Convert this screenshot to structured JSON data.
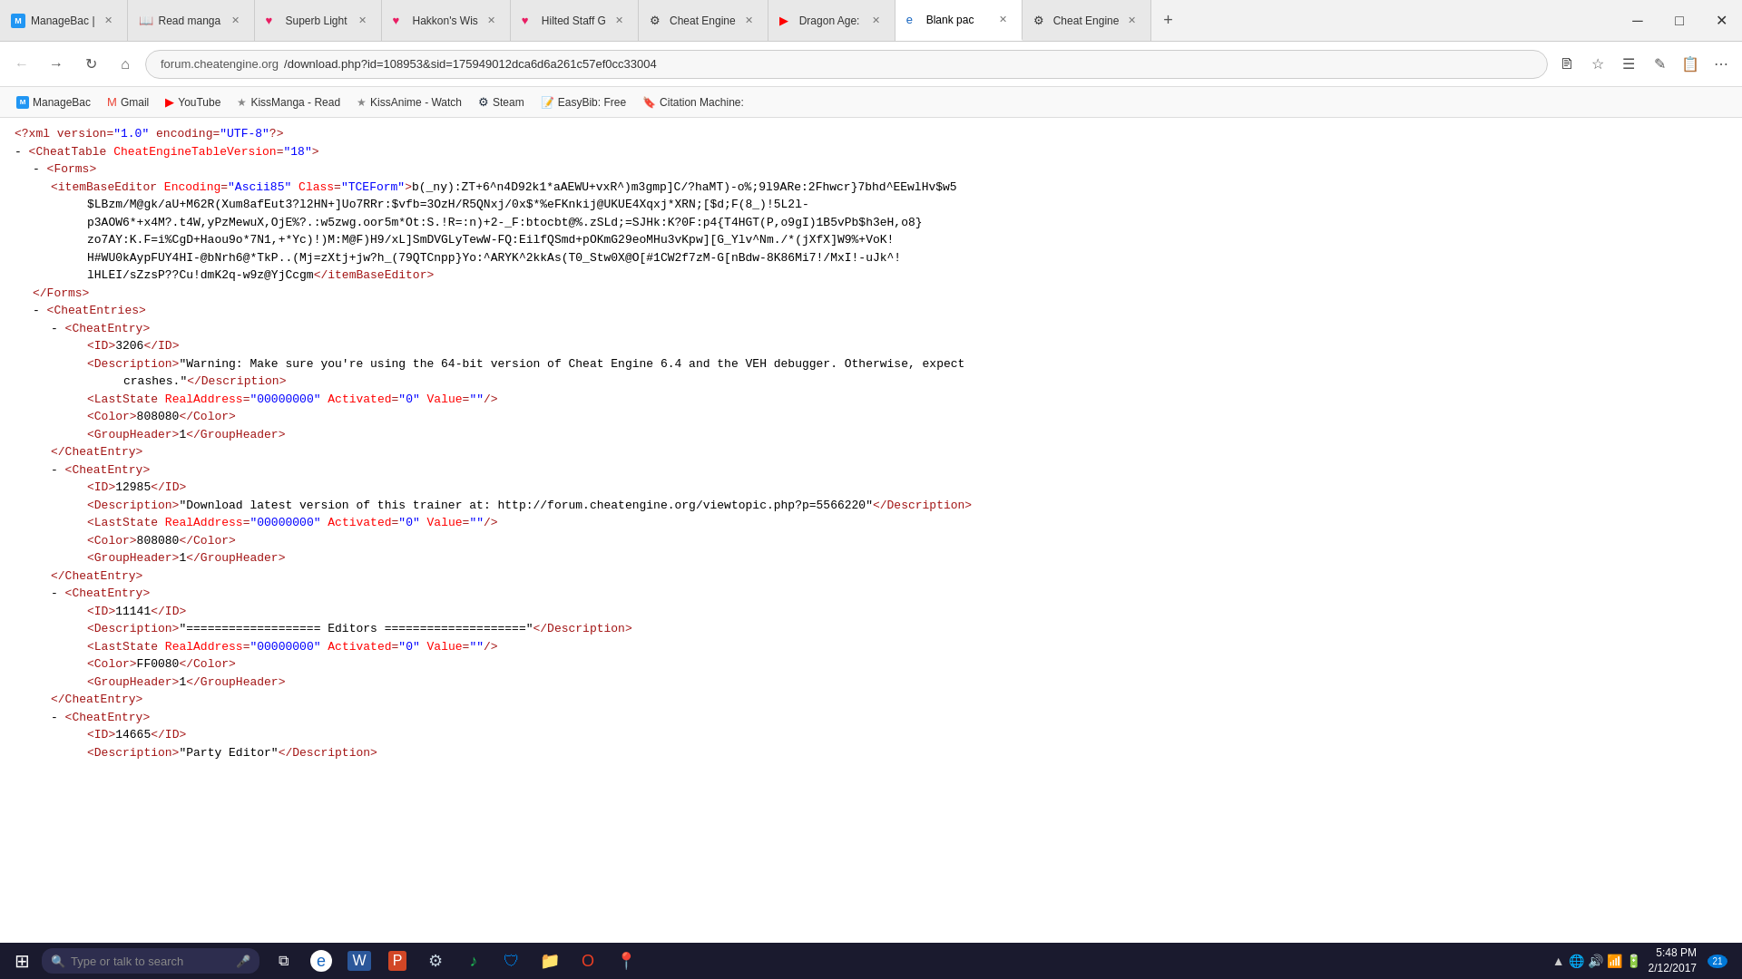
{
  "tabs": [
    {
      "id": "managebac",
      "label": "ManageBac |",
      "active": false,
      "icon": "M"
    },
    {
      "id": "readmanga",
      "label": "Read manga",
      "active": false,
      "icon": "📖"
    },
    {
      "id": "superblight",
      "label": "Superb Light",
      "active": false,
      "icon": "♥"
    },
    {
      "id": "hakkon",
      "label": "Hakkon's Wis",
      "active": false,
      "icon": "♥"
    },
    {
      "id": "hiltedstaff",
      "label": "Hilted Staff G",
      "active": false,
      "icon": "♥"
    },
    {
      "id": "cheatengine1",
      "label": "Cheat Engine",
      "active": false,
      "icon": "⚙"
    },
    {
      "id": "dragonage",
      "label": "Dragon Age:",
      "active": false,
      "icon": "▶"
    },
    {
      "id": "blankpac",
      "label": "Blank pac",
      "active": true,
      "icon": "e"
    },
    {
      "id": "cheatengine2",
      "label": "Cheat Engine",
      "active": false,
      "icon": "⚙"
    }
  ],
  "address": {
    "domain": "forum.cheatengine.org",
    "path": "/download.php?id=108953&sid=175949012dca6d6a261c57ef0cc33004"
  },
  "bookmarks": [
    {
      "label": "ManageBac",
      "icon": "M"
    },
    {
      "label": "Gmail",
      "icon": "M"
    },
    {
      "label": "YouTube",
      "icon": "▶"
    },
    {
      "label": "KissManga - Read",
      "icon": "★"
    },
    {
      "label": "KissAnime - Watch",
      "icon": "★"
    },
    {
      "label": "Steam",
      "icon": "⚙"
    },
    {
      "label": "EasyBib: Free",
      "icon": "📝"
    },
    {
      "label": "Citation Machine:",
      "icon": "🔖"
    }
  ],
  "content": {
    "lines": [
      {
        "indent": 0,
        "type": "comment",
        "text": "<?xml version=\"1.0\" encoding=\"utf-8\"?>"
      },
      {
        "indent": 0,
        "type": "tag-open",
        "dash": "-",
        "tag": "CheatTable",
        "attrs": [
          {
            "name": "CheatEngineTableVersion",
            "value": "18"
          }
        ]
      },
      {
        "indent": 1,
        "type": "tag-open",
        "dash": "-",
        "tag": "Forms"
      },
      {
        "indent": 2,
        "type": "complex",
        "content": "<itemBaseEditor Encoding=\"Ascii85\" Class=\"TCEForm\">b(_ny):ZT+6^n4D92k1*aAEWU+vxR^)m3gmp]C/?haMT)-o%;9l9ARe:2Fhwcr}7bhd^EEwlHv$w5"
      },
      {
        "indent": 2,
        "type": "encoded",
        "text": "$LBzm/M@gk/aU+M62R(Xum8afEut3?l2HN+]Uo7RRr:$vfb=3OzH/R5QNxj/0x$*%eFKnkij@UKUE4Xqxj*XRN;[$d;F(8_)!5L2l-"
      },
      {
        "indent": 2,
        "type": "encoded",
        "text": "p3AOW6*+x4M?.t4W,yPzMewuX,OjE%?.:w5zwg.oor5m*Ot:S.!R=:n)+2-_F:btocbt@%.zSLd;=SJHk:K?0F:p4{T4HGT(P,o9gI)1B5vPb$h3eH,o8}"
      },
      {
        "indent": 2,
        "type": "encoded",
        "text": "zo7AY:K.F=i%CgD+Haou9o*7N1,+*Yc)!)M:M@F)H9/xL]SmDVGLyTewW-FQ:EilfQSmd+pOKmG29eoMHu3vKpw][G_Ylv^Nm./*(jXfX]W9%+VoK!"
      },
      {
        "indent": 2,
        "type": "encoded",
        "text": "H#WU0kAypFUY4HI-@bNrh6@*TkP..(Mj=zXtj+jw?h_(79QTCnpp}Yo:^ARYK^2kkAs(T0_Stw0X@O[#1CW2f7zM-G[nBdw-8K86Mi7!/MxI!-uJk^!"
      },
      {
        "indent": 2,
        "type": "encoded",
        "text": "lHLEI/sZzsP??Cu!dmK2q-w9z@YjCcgm</itemBaseEditor>"
      },
      {
        "indent": 1,
        "type": "tag-close",
        "tag": "Forms"
      },
      {
        "indent": 1,
        "type": "tag-open",
        "dash": "-",
        "tag": "CheatEntries"
      },
      {
        "indent": 2,
        "type": "tag-open",
        "dash": "-",
        "tag": "CheatEntry"
      },
      {
        "indent": 3,
        "type": "simple",
        "tag": "ID",
        "value": "3206"
      },
      {
        "indent": 3,
        "type": "simple-text",
        "tag": "Description",
        "value": "\"Warning: Make sure you're using the 64-bit version of Cheat Engine 6.4 and the VEH debugger. Otherwise, expect"
      },
      {
        "indent": 3,
        "type": "continuation",
        "text": "crashes.\""
      },
      {
        "indent": 3,
        "type": "self-closing",
        "tag": "LastState",
        "attrs": [
          {
            "name": "RealAddress",
            "value": "00000000"
          },
          {
            "name": "Activated",
            "value": "0"
          },
          {
            "name": "Value",
            "value": ""
          }
        ]
      },
      {
        "indent": 3,
        "type": "simple",
        "tag": "Color",
        "value": "808080"
      },
      {
        "indent": 3,
        "type": "simple",
        "tag": "GroupHeader",
        "value": "1"
      },
      {
        "indent": 2,
        "type": "tag-close",
        "tag": "CheatEntry"
      },
      {
        "indent": 2,
        "type": "tag-open",
        "dash": "-",
        "tag": "CheatEntry"
      },
      {
        "indent": 3,
        "type": "simple",
        "tag": "ID",
        "value": "12985"
      },
      {
        "indent": 3,
        "type": "simple-text",
        "tag": "Description",
        "value": "\"Download latest version of this trainer at: http://forum.cheatengine.org/viewtopic.php?p=5566220\""
      },
      {
        "indent": 3,
        "type": "self-closing",
        "tag": "LastState",
        "attrs": [
          {
            "name": "RealAddress",
            "value": "00000000"
          },
          {
            "name": "Activated",
            "value": "0"
          },
          {
            "name": "Value",
            "value": ""
          }
        ]
      },
      {
        "indent": 3,
        "type": "simple",
        "tag": "Color",
        "value": "808080"
      },
      {
        "indent": 3,
        "type": "simple",
        "tag": "GroupHeader",
        "value": "1"
      },
      {
        "indent": 2,
        "type": "tag-close",
        "tag": "CheatEntry"
      },
      {
        "indent": 2,
        "type": "tag-open",
        "dash": "-",
        "tag": "CheatEntry"
      },
      {
        "indent": 3,
        "type": "simple",
        "tag": "ID",
        "value": "11141"
      },
      {
        "indent": 3,
        "type": "simple-text",
        "tag": "Description",
        "value": "\"=================== Editors ====================\""
      },
      {
        "indent": 3,
        "type": "self-closing",
        "tag": "LastState",
        "attrs": [
          {
            "name": "RealAddress",
            "value": "00000000"
          },
          {
            "name": "Activated",
            "value": "0"
          },
          {
            "name": "Value",
            "value": ""
          }
        ]
      },
      {
        "indent": 3,
        "type": "simple",
        "tag": "Color",
        "value": "FF0080"
      },
      {
        "indent": 3,
        "type": "simple",
        "tag": "GroupHeader",
        "value": "1"
      },
      {
        "indent": 2,
        "type": "tag-close",
        "tag": "CheatEntry"
      },
      {
        "indent": 2,
        "type": "tag-open",
        "dash": "-",
        "tag": "CheatEntry"
      },
      {
        "indent": 3,
        "type": "simple",
        "tag": "ID",
        "value": "14665"
      },
      {
        "indent": 3,
        "type": "simple-text",
        "tag": "Description",
        "value": "\"Party Editor\""
      }
    ]
  },
  "taskbar": {
    "search_placeholder": "Type or talk to search",
    "time": "5:48 PM",
    "date": "2/12/2017",
    "notification_count": "21",
    "apps": [
      "explorer",
      "edge",
      "word",
      "powerpoint",
      "steam",
      "spotify",
      "shield",
      "filemanager",
      "office",
      "maps"
    ]
  }
}
